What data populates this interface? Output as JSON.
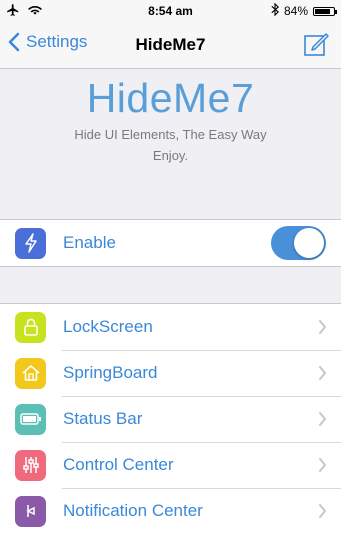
{
  "status_bar": {
    "time": "8:54 am",
    "battery_percent": "84%",
    "battery_level": 0.84,
    "icons": [
      "airplane-icon",
      "wifi-icon",
      "bluetooth-icon",
      "battery-icon"
    ]
  },
  "nav": {
    "back_label": "Settings",
    "title": "HideMe7",
    "accent_color": "#3b88d8"
  },
  "header": {
    "app_title": "HideMe7",
    "subtitle_line1": "Hide UI Elements, The Easy Way",
    "subtitle_line2": "Enjoy."
  },
  "enable_row": {
    "label": "Enable",
    "icon": "lightning-icon",
    "icon_color": "#4a6fd8",
    "toggle_on": true
  },
  "menu": {
    "items": [
      {
        "label": "LockScreen",
        "icon": "lock-icon",
        "color": "#c7e21f"
      },
      {
        "label": "SpringBoard",
        "icon": "home-icon",
        "color": "#f2c81c"
      },
      {
        "label": "Status Bar",
        "icon": "battery-icon",
        "color": "#5bbfb6"
      },
      {
        "label": "Control Center",
        "icon": "sliders-icon",
        "color": "#ee6a7c"
      },
      {
        "label": "Notification Center",
        "icon": "notification-icon",
        "color": "#8a5aa8"
      }
    ]
  }
}
